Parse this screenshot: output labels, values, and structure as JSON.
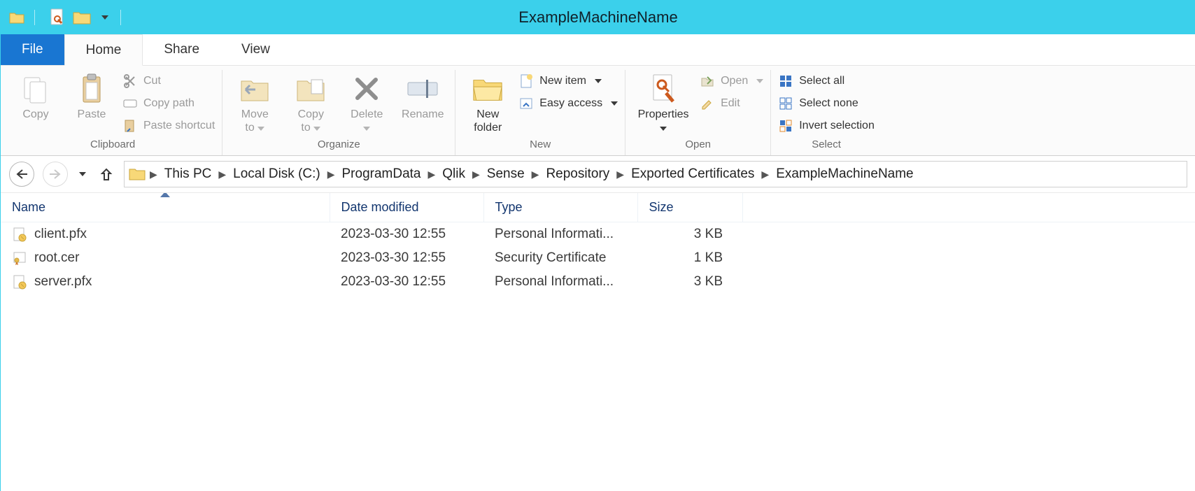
{
  "window": {
    "title": "ExampleMachineName"
  },
  "tabs": {
    "file": "File",
    "home": "Home",
    "share": "Share",
    "view": "View"
  },
  "ribbon": {
    "clipboard": {
      "title": "Clipboard",
      "copy": "Copy",
      "paste": "Paste",
      "cut": "Cut",
      "copy_path": "Copy path",
      "paste_shortcut": "Paste shortcut"
    },
    "organize": {
      "title": "Organize",
      "move_to": "Move\nto",
      "copy_to": "Copy\nto",
      "delete": "Delete",
      "rename": "Rename"
    },
    "new": {
      "title": "New",
      "new_folder": "New\nfolder",
      "new_item": "New item",
      "easy_access": "Easy access"
    },
    "open": {
      "title": "Open",
      "properties": "Properties",
      "open": "Open",
      "edit": "Edit"
    },
    "select": {
      "title": "Select",
      "select_all": "Select all",
      "select_none": "Select none",
      "invert": "Invert selection"
    }
  },
  "breadcrumb": {
    "items": [
      "This PC",
      "Local Disk (C:)",
      "ProgramData",
      "Qlik",
      "Sense",
      "Repository",
      "Exported Certificates",
      "ExampleMachineName"
    ]
  },
  "columns": {
    "name": "Name",
    "date": "Date modified",
    "type": "Type",
    "size": "Size"
  },
  "files": [
    {
      "name": "client.pfx",
      "date": "2023-03-30 12:55",
      "type": "Personal Informati...",
      "size": "3 KB",
      "icon": "pfx"
    },
    {
      "name": "root.cer",
      "date": "2023-03-30 12:55",
      "type": "Security Certificate",
      "size": "1 KB",
      "icon": "cer"
    },
    {
      "name": "server.pfx",
      "date": "2023-03-30 12:55",
      "type": "Personal Informati...",
      "size": "3 KB",
      "icon": "pfx"
    }
  ]
}
